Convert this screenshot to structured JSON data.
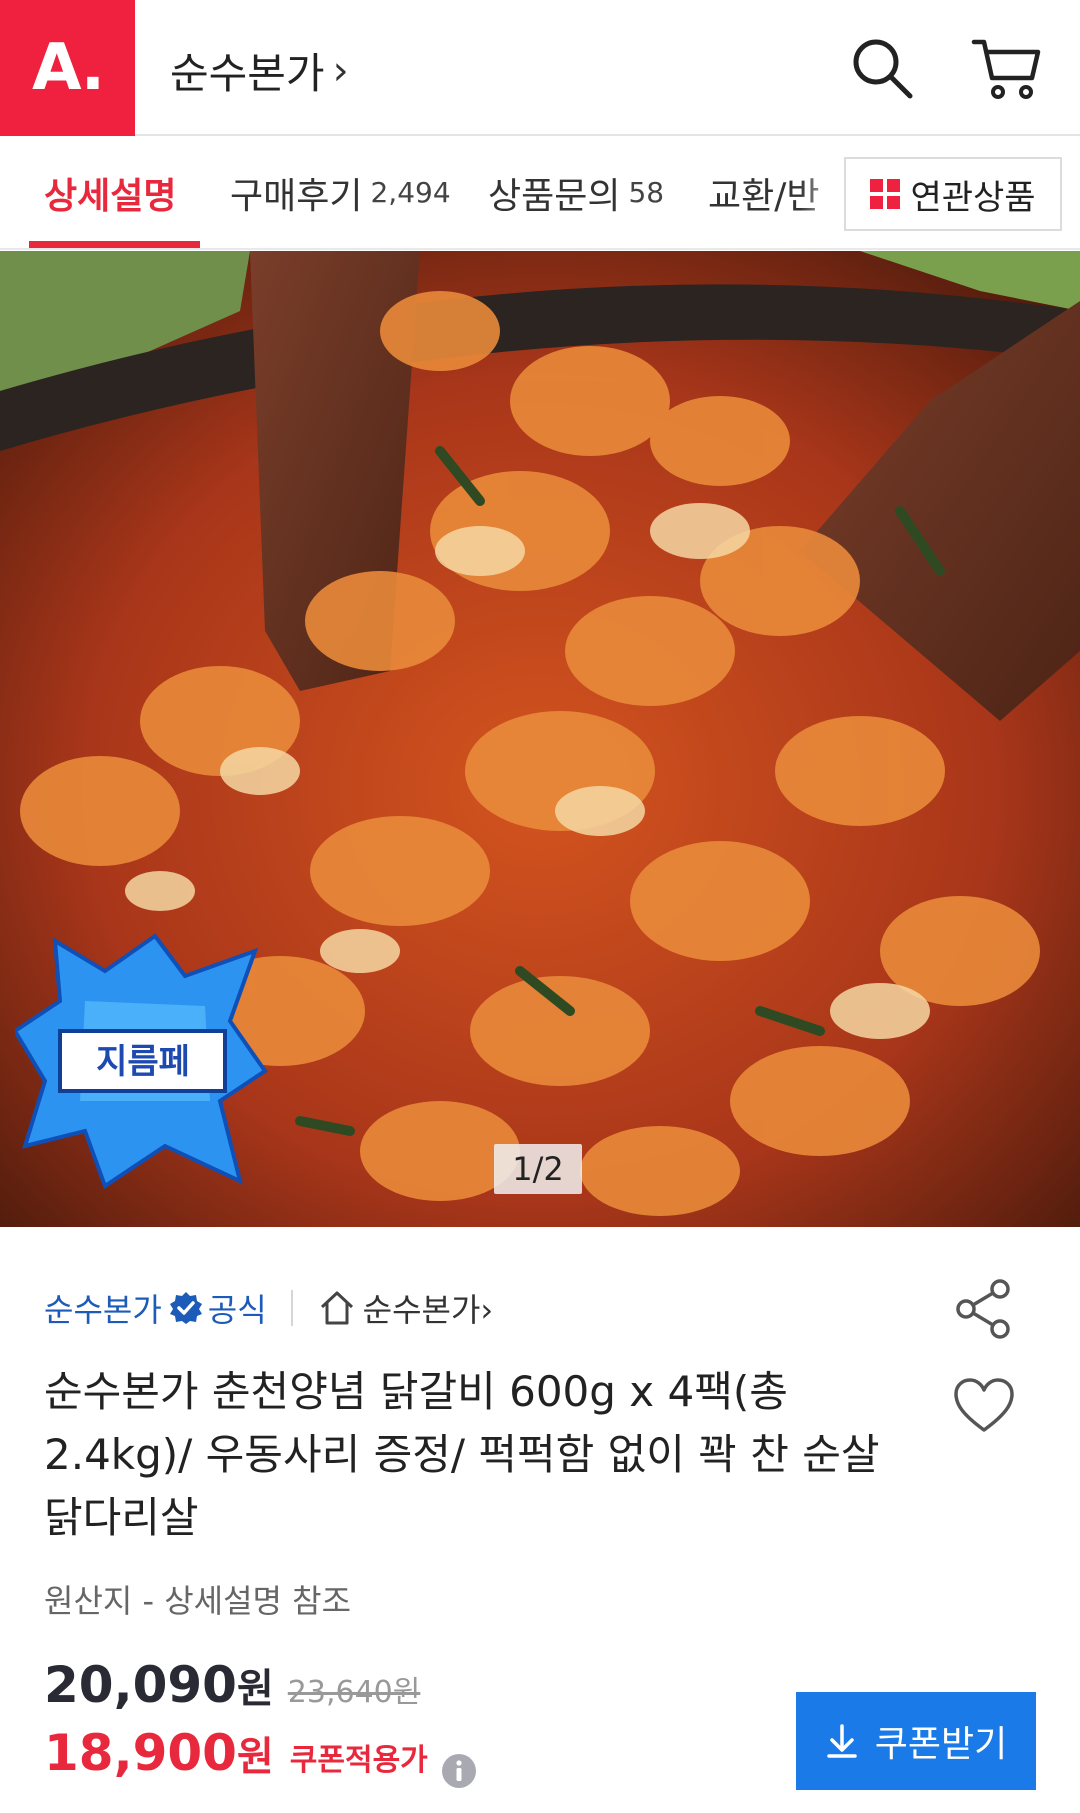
{
  "header": {
    "logo_text": "A.",
    "store_title": "순수본가",
    "store_chevron": "›",
    "brand_color": "#f0203f"
  },
  "tabs": {
    "items": [
      {
        "label": "상세설명",
        "count": ""
      },
      {
        "label": "구매후기",
        "count": "2,494"
      },
      {
        "label": "상품문의",
        "count": "58"
      },
      {
        "label": "교환/반",
        "count": ""
      }
    ],
    "related_label": "연관상품",
    "active_color": "#e8293d"
  },
  "hero": {
    "counter": "1/2",
    "badge_text": "지름페"
  },
  "product": {
    "seller_name": "순수본가",
    "official_label": "공식",
    "store_link": "순수본가",
    "store_link_chevron": "›",
    "title": "순수본가 춘천양념 닭갈비 600g x 4팩(총2.4kg)/ 우동사리 증정/ 퍽퍽함 없이 꽉 찬 순살 닭다리살",
    "origin": "원산지 - 상세설명 참조"
  },
  "pricing": {
    "price": "20,090",
    "currency": "원",
    "original_price": "23,640원",
    "coupon_price": "18,900",
    "coupon_currency": "원",
    "coupon_label": "쿠폰적용가",
    "coupon_button_label": "쿠폰받기",
    "coupon_button_color": "#1a7ae8"
  }
}
